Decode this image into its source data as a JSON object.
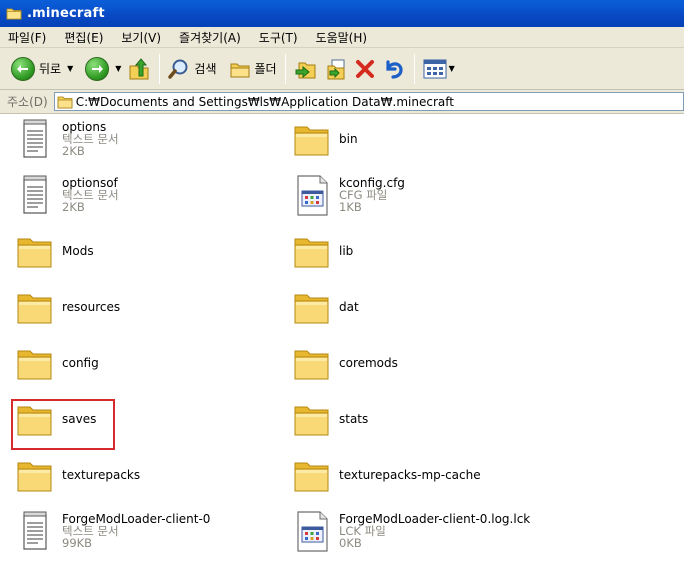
{
  "window": {
    "title": ".minecraft",
    "folder_icon": "folder-icon"
  },
  "menu": [
    "파일(F)",
    "편집(E)",
    "보기(V)",
    "즐겨찾기(A)",
    "도구(T)",
    "도움말(H)"
  ],
  "toolbar": {
    "back_label": "뒤로",
    "search_label": "검색",
    "folders_label": "폴더"
  },
  "address": {
    "label": "주소(D)",
    "path": "C:₩Documents and Settings₩ls₩Application Data₩.minecraft"
  },
  "files": [
    {
      "name": "options",
      "type": "텍스트 문서",
      "size": "2KB",
      "icon": "text-document-icon"
    },
    {
      "name": "bin",
      "type": "",
      "size": "",
      "icon": "folder-icon"
    },
    {
      "name": "optionsof",
      "type": "텍스트 문서",
      "size": "2KB",
      "icon": "text-document-icon"
    },
    {
      "name": "kconfig.cfg",
      "type": "CFG 파일",
      "size": "1KB",
      "icon": "config-file-icon"
    },
    {
      "name": "Mods",
      "type": "",
      "size": "",
      "icon": "folder-icon"
    },
    {
      "name": "lib",
      "type": "",
      "size": "",
      "icon": "folder-icon"
    },
    {
      "name": "resources",
      "type": "",
      "size": "",
      "icon": "folder-icon"
    },
    {
      "name": "dat",
      "type": "",
      "size": "",
      "icon": "folder-icon"
    },
    {
      "name": "config",
      "type": "",
      "size": "",
      "icon": "folder-icon"
    },
    {
      "name": "coremods",
      "type": "",
      "size": "",
      "icon": "folder-icon"
    },
    {
      "name": "saves",
      "type": "",
      "size": "",
      "icon": "folder-icon"
    },
    {
      "name": "stats",
      "type": "",
      "size": "",
      "icon": "folder-icon"
    },
    {
      "name": "texturepacks",
      "type": "",
      "size": "",
      "icon": "folder-icon"
    },
    {
      "name": "texturepacks-mp-cache",
      "type": "",
      "size": "",
      "icon": "folder-icon"
    },
    {
      "name": "ForgeModLoader-client-0",
      "type": "텍스트 문서",
      "size": "99KB",
      "icon": "text-document-icon"
    },
    {
      "name": "ForgeModLoader-client-0.log.lck",
      "type": "LCK 파일",
      "size": "0KB",
      "icon": "config-file-icon"
    }
  ],
  "highlight_color": "#d72a2a",
  "titlebar_color": "#0a5fd8"
}
